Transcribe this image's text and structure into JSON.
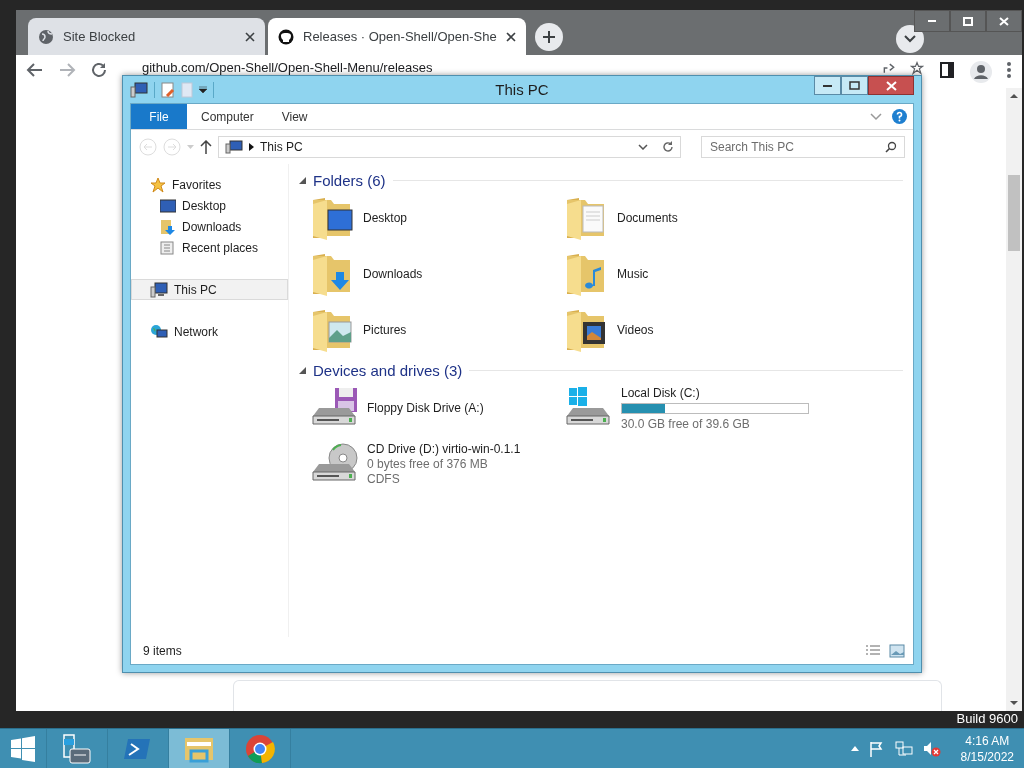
{
  "desktop": {
    "watermark": "Build 9600"
  },
  "browser": {
    "tabs": [
      {
        "label": "Site Blocked",
        "selected": false
      },
      {
        "label": "Releases · Open-Shell/Open-She",
        "selected": true
      }
    ],
    "url": "github.com/Open-Shell/Open-Shell-Menu/releases"
  },
  "explorer": {
    "title": "This PC",
    "ribbon_tabs": [
      {
        "label": "File",
        "kind": "menu",
        "selected": false
      },
      {
        "label": "Computer",
        "kind": "tab",
        "selected": false
      },
      {
        "label": "View",
        "kind": "tab",
        "selected": false
      }
    ],
    "address": "This PC",
    "search": {
      "placeholder": "Search This PC"
    },
    "nav": [
      {
        "label": "Favorites",
        "selected": false,
        "children": [
          {
            "label": "Desktop",
            "selected": false
          },
          {
            "label": "Downloads",
            "selected": false
          },
          {
            "label": "Recent places",
            "selected": false
          }
        ]
      },
      {
        "label": "This PC",
        "selected": true
      },
      {
        "label": "Network",
        "selected": false
      }
    ],
    "groups": [
      {
        "title": "Folders (6)",
        "expanded": true,
        "items": [
          {
            "name": "Desktop"
          },
          {
            "name": "Documents"
          },
          {
            "name": "Downloads"
          },
          {
            "name": "Music"
          },
          {
            "name": "Pictures"
          },
          {
            "name": "Videos"
          }
        ]
      },
      {
        "title": "Devices and drives (3)",
        "expanded": true,
        "items": [
          {
            "kind": "floppy",
            "name": "Floppy Disk Drive (A:)"
          },
          {
            "kind": "disk",
            "name": "Local Disk (C:)",
            "level": 0.23,
            "details": [
              "30.0 GB free of 39.6 GB"
            ]
          },
          {
            "kind": "cd",
            "name": "CD Drive (D:) virtio-win-0.1.1",
            "details": [
              "0 bytes free of 376 MB",
              "CDFS"
            ]
          }
        ]
      }
    ],
    "status": "9 items"
  },
  "taskbar": {
    "apps": [
      {
        "selected": false
      },
      {
        "selected": false
      },
      {
        "selected": true
      },
      {
        "selected": false
      }
    ],
    "time": "4:16 AM",
    "date": "8/15/2022"
  }
}
